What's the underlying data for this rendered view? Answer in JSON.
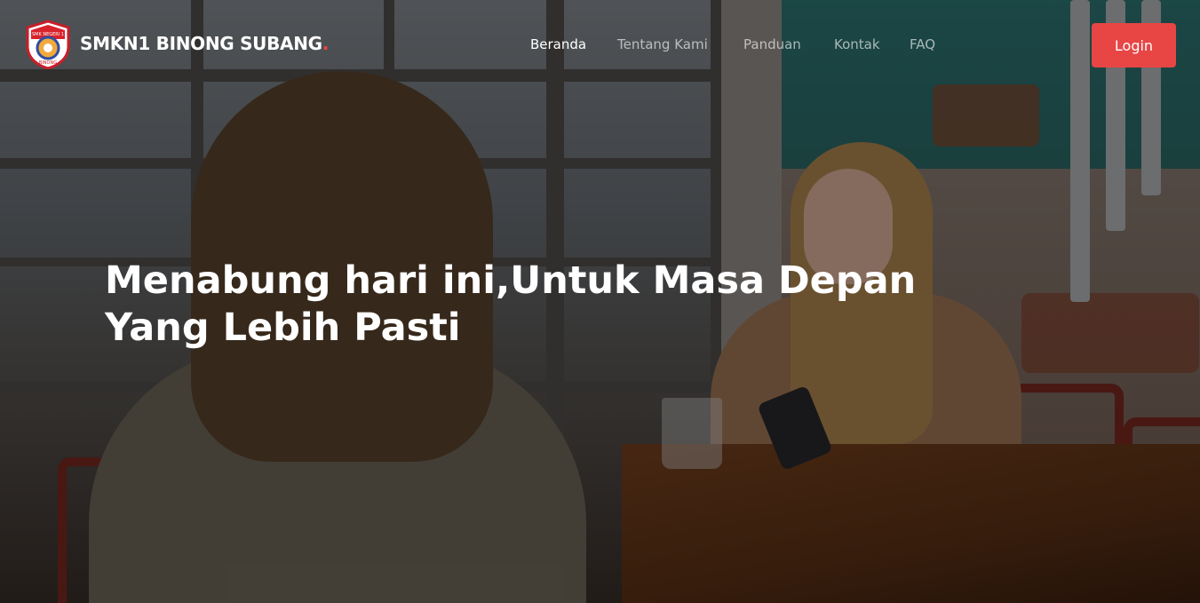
{
  "brand": {
    "name": "SMKN1 BINONG SUBANG",
    "dot": ".",
    "logo_text_top": "SMK NEGERI 1",
    "logo_text_bottom": "BINONG"
  },
  "nav": {
    "items": [
      {
        "label": "Beranda",
        "active": true
      },
      {
        "label": "Tentang Kami",
        "active": false
      },
      {
        "label": "Panduan",
        "active": false
      },
      {
        "label": "Kontak",
        "active": false
      },
      {
        "label": "FAQ",
        "active": false
      }
    ]
  },
  "login": {
    "label": "Login"
  },
  "hero": {
    "headline_line1": "Menabung hari ini,Untuk Masa Depan",
    "headline_line2": "Yang Lebih Pasti"
  },
  "colors": {
    "accent": "#e84545",
    "text": "#ffffff"
  },
  "icons": {
    "logo": "school-crest-icon"
  }
}
